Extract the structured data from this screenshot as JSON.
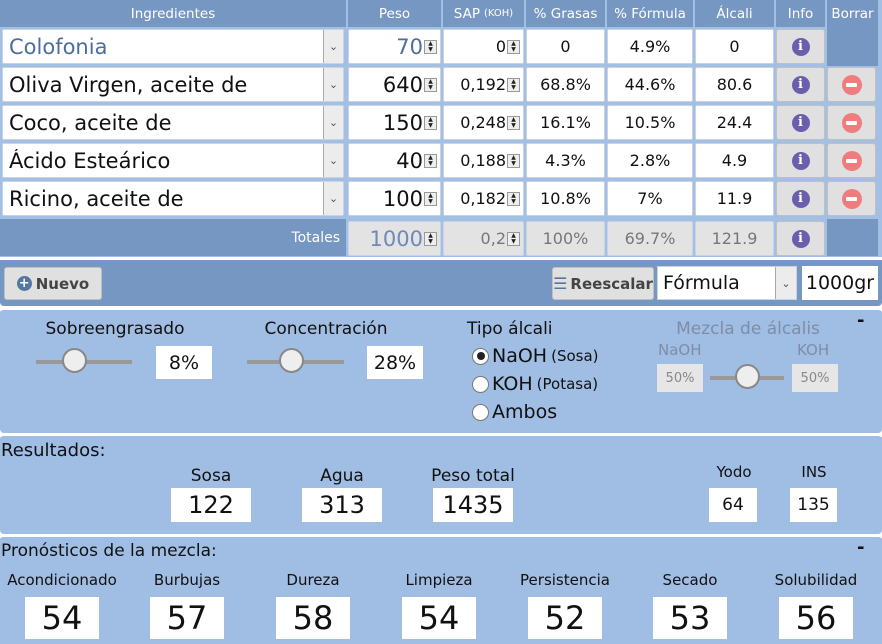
{
  "table": {
    "headers": {
      "ingredientes": "Ingredientes",
      "peso": "Peso",
      "sap": "SAP",
      "sap_unit": "(KOH)",
      "grasas": "% Grasas",
      "formula": "% Fórmula",
      "alcali": "Álcali",
      "info": "Info",
      "borrar": "Borrar"
    },
    "rows": [
      {
        "ingrediente": "Colofonia",
        "peso": "70",
        "sap": "0",
        "grasas": "0",
        "formula": "4.9%",
        "alcali": "0",
        "deletable": false
      },
      {
        "ingrediente": "Oliva Virgen, aceite de",
        "peso": "640",
        "sap": "0,192",
        "grasas": "68.8%",
        "formula": "44.6%",
        "alcali": "80.6",
        "deletable": true
      },
      {
        "ingrediente": "Coco, aceite de",
        "peso": "150",
        "sap": "0,248",
        "grasas": "16.1%",
        "formula": "10.5%",
        "alcali": "24.4",
        "deletable": true
      },
      {
        "ingrediente": "Ácido Esteárico",
        "peso": "40",
        "sap": "0,188",
        "grasas": "4.3%",
        "formula": "2.8%",
        "alcali": "4.9",
        "deletable": true
      },
      {
        "ingrediente": "Ricino, aceite de",
        "peso": "100",
        "sap": "0,182",
        "grasas": "10.8%",
        "formula": "7%",
        "alcali": "11.9",
        "deletable": true
      }
    ],
    "totals": {
      "label": "Totales",
      "peso": "1000",
      "sap": "0,2",
      "grasas": "100%",
      "formula": "69.7%",
      "alcali": "121.9"
    }
  },
  "toolbar": {
    "new_label": "Nuevo",
    "rescale_label": "Reescalar",
    "scale_mode": "Fórmula",
    "scale_value": "1000gr"
  },
  "settings": {
    "superfat_label": "Sobreengrasado",
    "superfat_value": "8%",
    "superfat_fraction": 0.4,
    "concentration_label": "Concentración",
    "concentration_value": "28%",
    "concentration_fraction": 0.45,
    "alkali_type_label": "Tipo álcali",
    "alkali_options": [
      {
        "label": "NaOH",
        "hint": "(Sosa)",
        "selected": true
      },
      {
        "label": "KOH",
        "hint": "(Potasa)",
        "selected": false
      },
      {
        "label": "Ambos",
        "hint": "",
        "selected": false
      }
    ],
    "mix_label": "Mezcla de álcalis",
    "mix_naoh_label": "NaOH",
    "mix_koh_label": "KOH",
    "mix_naoh_value": "50%",
    "mix_koh_value": "50%",
    "collapse": "-"
  },
  "results": {
    "title": "Resultados:",
    "items": [
      {
        "label": "Sosa",
        "value": "122"
      },
      {
        "label": "Agua",
        "value": "313"
      },
      {
        "label": "Peso total",
        "value": "1435"
      }
    ],
    "indices": [
      {
        "label": "Yodo",
        "value": "64"
      },
      {
        "label": "INS",
        "value": "135"
      }
    ]
  },
  "forecast": {
    "title": "Pronósticos de la mezcla:",
    "collapse": "-",
    "items": [
      {
        "label": "Acondicionado",
        "value": "54"
      },
      {
        "label": "Burbujas",
        "value": "57"
      },
      {
        "label": "Dureza",
        "value": "58"
      },
      {
        "label": "Limpieza",
        "value": "54"
      },
      {
        "label": "Persistencia",
        "value": "52"
      },
      {
        "label": "Secado",
        "value": "53"
      },
      {
        "label": "Solubilidad",
        "value": "56"
      }
    ]
  }
}
